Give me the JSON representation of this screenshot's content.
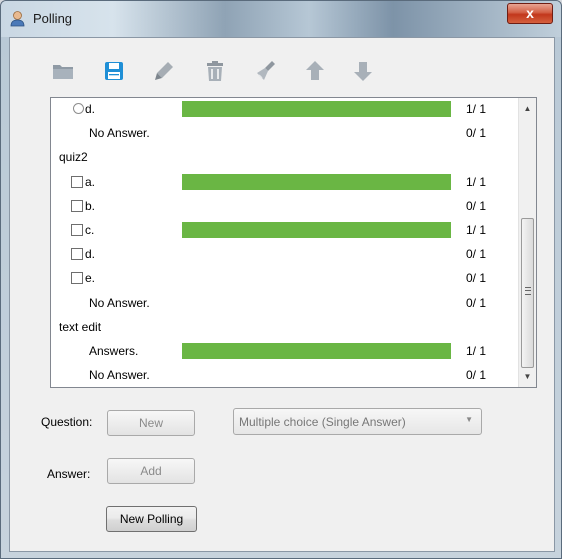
{
  "window": {
    "title": "Polling",
    "close_label": "x"
  },
  "toolbar": {
    "buttons": [
      {
        "name": "open-folder-icon"
      },
      {
        "name": "save-icon"
      },
      {
        "name": "edit-pencil-icon"
      },
      {
        "name": "delete-trash-icon"
      },
      {
        "name": "clear-broom-icon"
      },
      {
        "name": "move-up-arrow-icon"
      },
      {
        "name": "move-down-arrow-icon"
      }
    ]
  },
  "results": {
    "rows": [
      {
        "type": "option",
        "mark": "radio",
        "label": "d.",
        "fill": 1,
        "count": "1/ 1"
      },
      {
        "type": "option",
        "mark": "none",
        "label": "No Answer.",
        "fill": 0,
        "count": "0/ 1"
      },
      {
        "type": "heading",
        "label": "quiz2"
      },
      {
        "type": "option",
        "mark": "checkbox",
        "label": "a.",
        "fill": 1,
        "count": "1/ 1"
      },
      {
        "type": "option",
        "mark": "checkbox",
        "label": "b.",
        "fill": 0,
        "count": "0/ 1"
      },
      {
        "type": "option",
        "mark": "checkbox",
        "label": "c.",
        "fill": 1,
        "count": "1/ 1"
      },
      {
        "type": "option",
        "mark": "checkbox",
        "label": "d.",
        "fill": 0,
        "count": "0/ 1"
      },
      {
        "type": "option",
        "mark": "checkbox",
        "label": "e.",
        "fill": 0,
        "count": "0/ 1"
      },
      {
        "type": "option",
        "mark": "none",
        "label": "No Answer.",
        "fill": 0,
        "count": "0/ 1"
      },
      {
        "type": "heading",
        "label": "text edit"
      },
      {
        "type": "option",
        "mark": "none",
        "label": "Answers.",
        "fill": 1,
        "count": "1/ 1"
      },
      {
        "type": "option",
        "mark": "none",
        "label": "No Answer.",
        "fill": 0,
        "count": "0/ 1"
      }
    ],
    "scrollbar": {
      "up_icon": "scroll-up-arrow-icon",
      "down_icon": "scroll-down-arrow-icon"
    }
  },
  "form": {
    "question_label": "Question:",
    "new_button": "New",
    "question_type": "Multiple choice (Single Answer)",
    "answer_label": "Answer:",
    "add_button": "Add",
    "new_polling_button": "New Polling"
  },
  "colors": {
    "bar": "#6ab644",
    "toolbar_accent": "#1f8fd6"
  }
}
